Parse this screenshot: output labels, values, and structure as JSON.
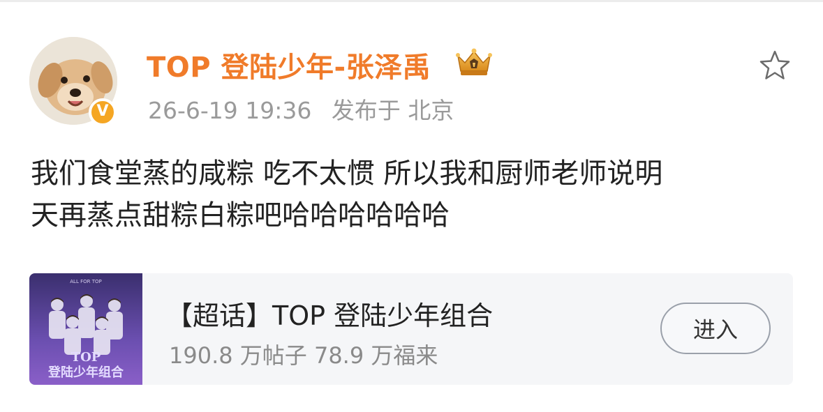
{
  "post": {
    "username": "TOP 登陆少年-张泽禹",
    "verified_badge_label": "V",
    "time": "26-6-19 19:36",
    "location": "发布于 北京",
    "text_lines": [
      "我们食堂蒸的咸粽 吃不太惯 所以我和厨师老师说明",
      "天再蒸点甜粽白粽吧哈哈哈哈哈哈"
    ],
    "icons": {
      "avatar": "puppy-avatar",
      "badge": "verified-v-icon",
      "crown": "crown-icon",
      "favorite": "star-icon"
    }
  },
  "supertopic": {
    "title": "【超话】TOP 登陆少年组合",
    "stats": "190.8 万帖子 78.9 万福来",
    "button_label": "进入",
    "thumbnail_caption_top": "ALL FOR TOP",
    "thumbnail_caption_line1": "TOP",
    "thumbnail_caption_line2": "登陆少年组合"
  },
  "colors": {
    "username": "#f07b2a",
    "meta": "#9a9a9a",
    "badge": "#f5a623",
    "card_bg": "#f5f6f8"
  }
}
